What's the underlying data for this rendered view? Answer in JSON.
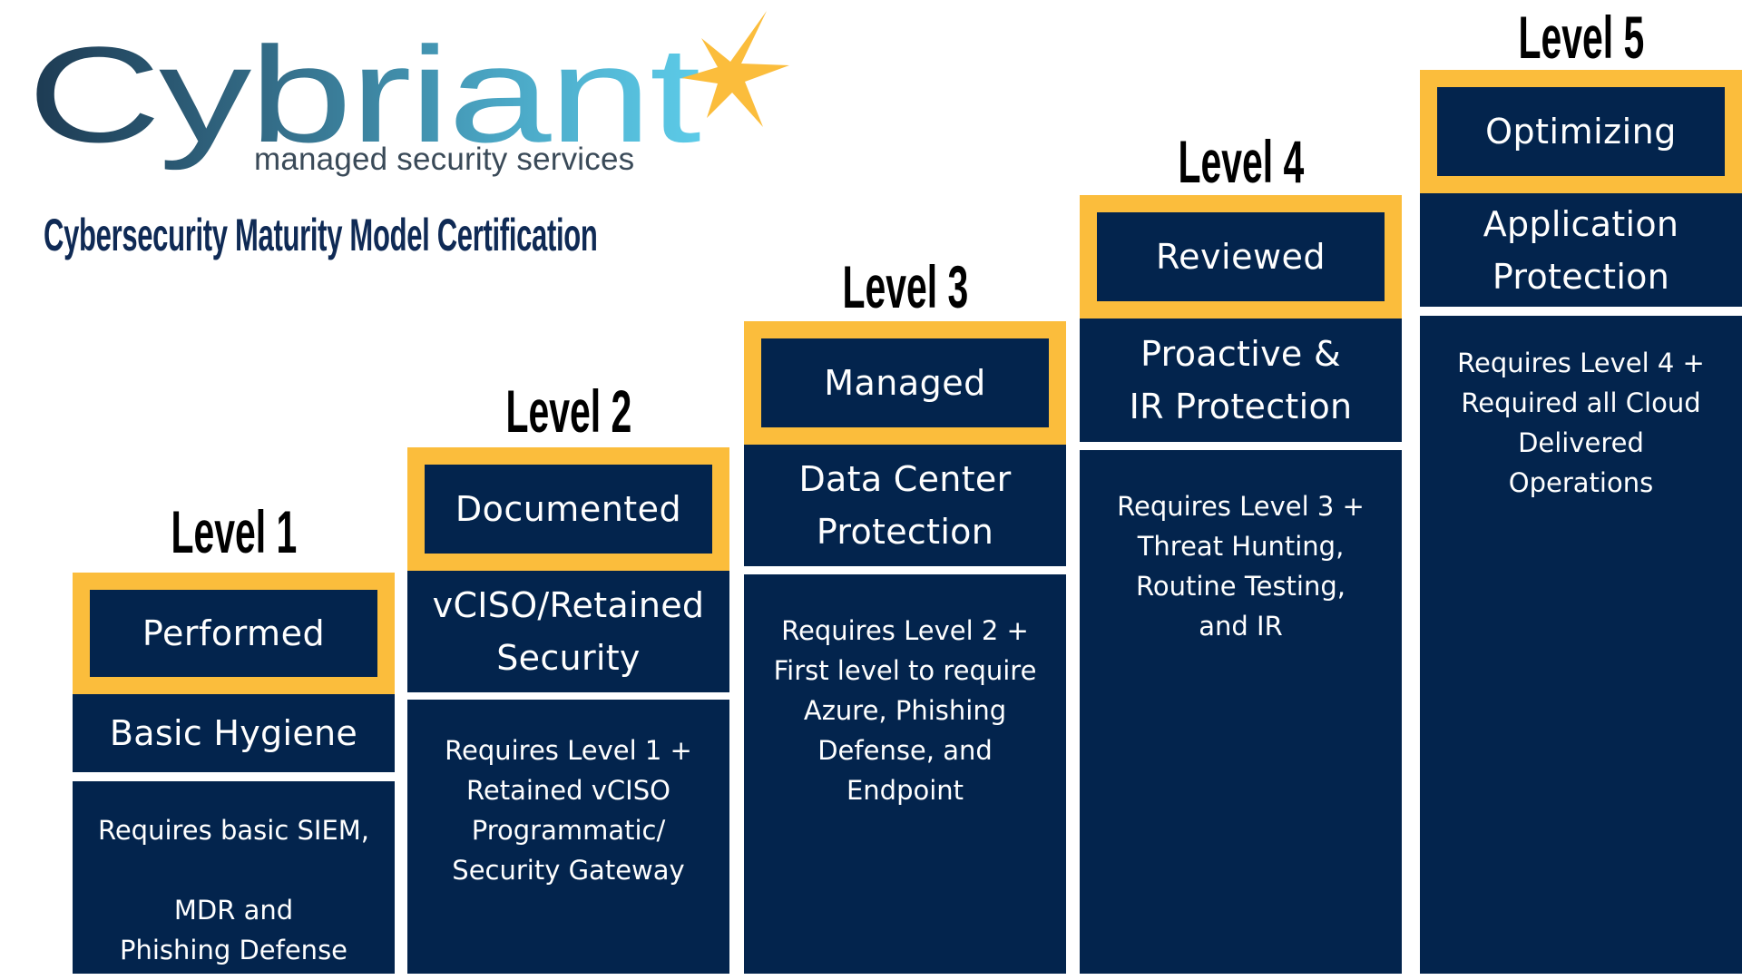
{
  "logo": {
    "wordmark": "Cybriant",
    "tagline": "managed security services",
    "icon": "star-burst-icon",
    "colors": {
      "dark": "#1d3a52",
      "mid": "#3f7a96",
      "light": "#5ccbe8",
      "star": "#fbbd3c"
    }
  },
  "title": "Cybersecurity Maturity Model Certification",
  "colors": {
    "navy": "#03244d",
    "gold": "#fbbd3c",
    "title": "#0f2a55"
  },
  "levels": [
    {
      "heading": "Level 1",
      "name": "Performed",
      "focus": "Basic Hygiene",
      "description": "Requires basic  SIEM,\n\nMDR and\nPhishing Defense"
    },
    {
      "heading": "Level 2",
      "name": "Documented",
      "focus": "vCISO/Retained\nSecurity",
      "description": "Requires Level 1 +\nRetained vCISO\nProgrammatic/\nSecurity Gateway"
    },
    {
      "heading": "Level 3",
      "name": "Managed",
      "focus": "Data Center\nProtection",
      "description": "Requires Level 2 +\nFirst level to require\nAzure, Phishing\nDefense, and\nEndpoint"
    },
    {
      "heading": "Level 4",
      "name": "Reviewed",
      "focus": "Proactive &\nIR Protection",
      "description": "Requires Level 3 +\nThreat Hunting,\nRoutine Testing,\nand IR"
    },
    {
      "heading": "Level 5",
      "name": "Optimizing",
      "focus": "Application\nProtection",
      "description": "Requires Level 4 +\nRequired all Cloud\nDelivered\nOperations"
    }
  ]
}
